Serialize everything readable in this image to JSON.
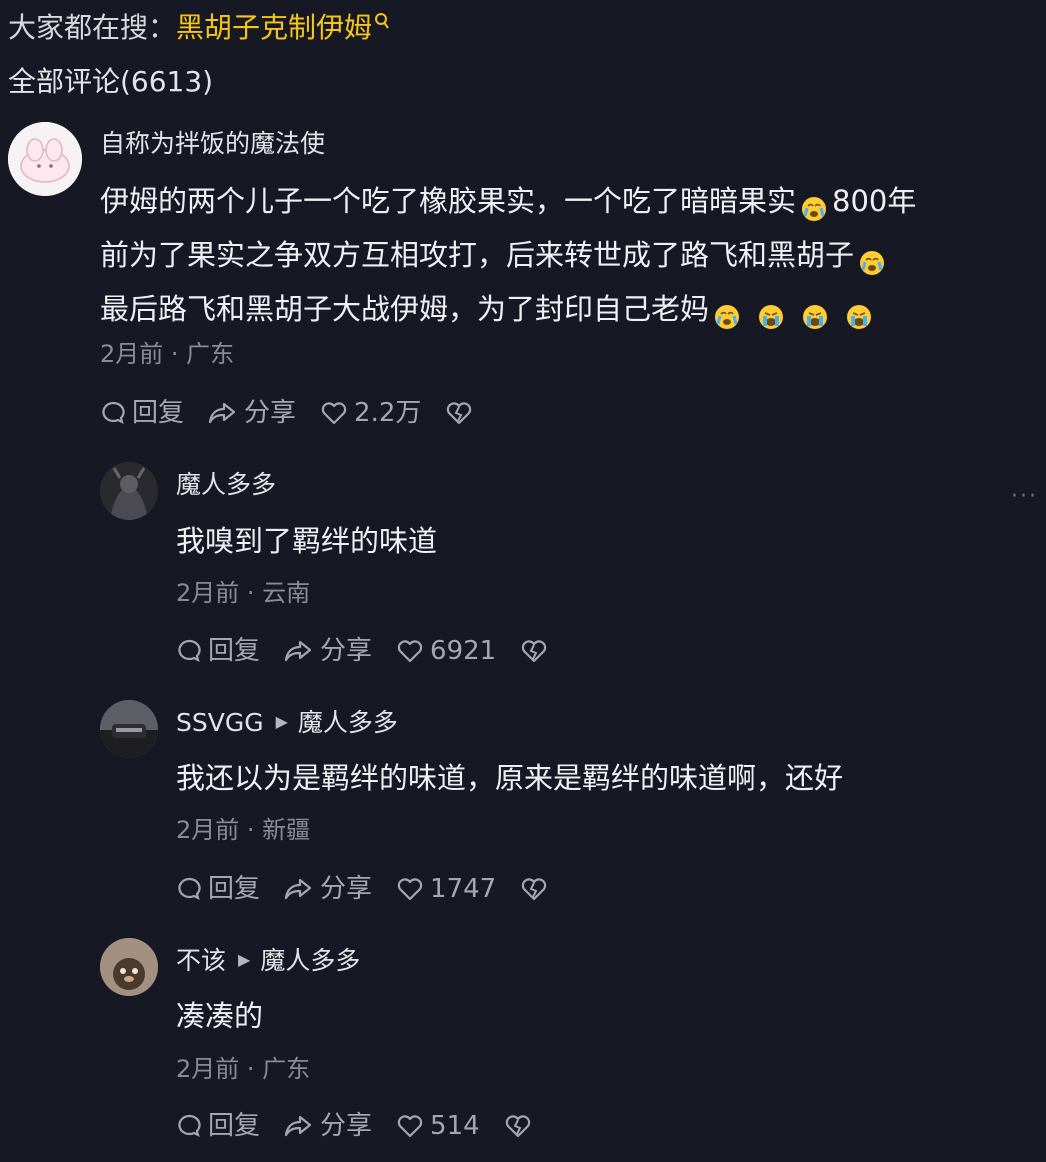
{
  "search_hint": {
    "prefix": "大家都在搜：",
    "keyword": "黑胡子克制伊姆"
  },
  "comment_count_label": "全部评论(6613)",
  "comments": [
    {
      "username": "自称为拌饭的魔法使",
      "text_lines": [
        [
          "伊姆的两个儿子一个吃了橡胶果实，一个吃了暗暗果实",
          "800年"
        ],
        [
          "前为了果实之争双方互相攻打，后来转世成了路飞和黑胡子",
          ""
        ],
        [
          "最后路飞和黑胡子大战伊姆，为了封印自己老妈",
          ""
        ]
      ],
      "time": "2月前",
      "location": "广东",
      "reply_label": "回复",
      "share_label": "分享",
      "like_count": "2.2万"
    },
    {
      "username": "魔人多多",
      "text": "我嗅到了羁绊的味道",
      "time": "2月前",
      "location": "云南",
      "reply_label": "回复",
      "share_label": "分享",
      "like_count": "6921"
    },
    {
      "username": "SSVGG",
      "reply_to": "魔人多多",
      "text": "我还以为是羁绊的味道，原来是羁绊的味道啊，还好",
      "time": "2月前",
      "location": "新疆",
      "reply_label": "回复",
      "share_label": "分享",
      "like_count": "1747"
    },
    {
      "username": "不该",
      "reply_to": "魔人多多",
      "text": "凑凑的",
      "time": "2月前",
      "location": "广东",
      "reply_label": "回复",
      "share_label": "分享",
      "like_count": "514"
    }
  ],
  "colors": {
    "background": "#161823",
    "keyword": "#f5c517",
    "meta": "#8a8b93"
  },
  "icons": [
    "search-icon",
    "comment-icon",
    "share-icon",
    "heart-icon",
    "dislike-icon",
    "crying-emoji",
    "more-icon"
  ]
}
